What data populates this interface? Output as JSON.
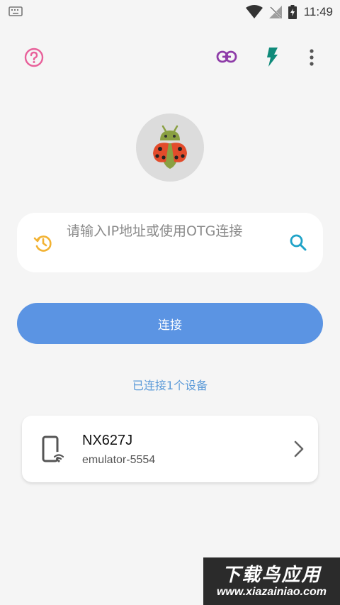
{
  "status_bar": {
    "time": "11:49",
    "icons": [
      "keyboard-icon",
      "wifi-icon",
      "signal-off-icon",
      "battery-charging-icon"
    ]
  },
  "toolbar": {
    "icons": [
      "help-icon",
      "link-icon",
      "flash-icon",
      "more-vert-icon"
    ],
    "colors": {
      "help": "#e8609a",
      "link": "#8e3ca8",
      "flash": "#0f8a7a",
      "more": "#555555"
    }
  },
  "logo": {
    "icon": "ladybug-android-icon"
  },
  "search": {
    "placeholder": "请输入IP地址或使用OTG连接",
    "value": ""
  },
  "connect_button": {
    "label": "连接",
    "color": "#5b94e3"
  },
  "connected_status": "已连接1个设备",
  "devices": [
    {
      "name": "NX627J",
      "serial": "emulator-5554"
    }
  ],
  "watermark": {
    "title": "下载鸟应用",
    "url": "www.xiazainiao.com"
  }
}
